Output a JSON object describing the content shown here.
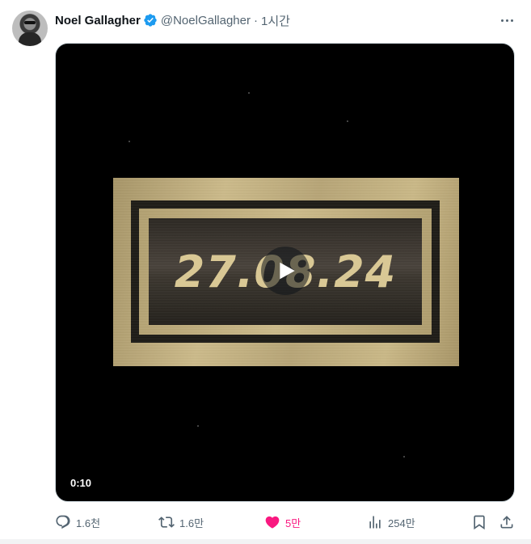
{
  "author": {
    "display_name": "Noel Gallagher",
    "handle": "@NoelGallagher",
    "separator": "·",
    "time": "1시간"
  },
  "media": {
    "plate_text": "27.08.24",
    "duration": "0:10"
  },
  "actions": {
    "reply": {
      "icon": "reply-icon",
      "count": "1.6천"
    },
    "repost": {
      "icon": "repost-icon",
      "count": "1.6만"
    },
    "like": {
      "icon": "heart-icon",
      "count": "5만",
      "liked": true
    },
    "views": {
      "icon": "views-icon",
      "count": "254만"
    },
    "bookmark": {
      "icon": "bookmark-icon"
    },
    "share": {
      "icon": "share-icon"
    }
  },
  "colors": {
    "text": "#0f1419",
    "secondary": "#536471",
    "verified": "#1d9bf0",
    "like": "#f91880"
  }
}
